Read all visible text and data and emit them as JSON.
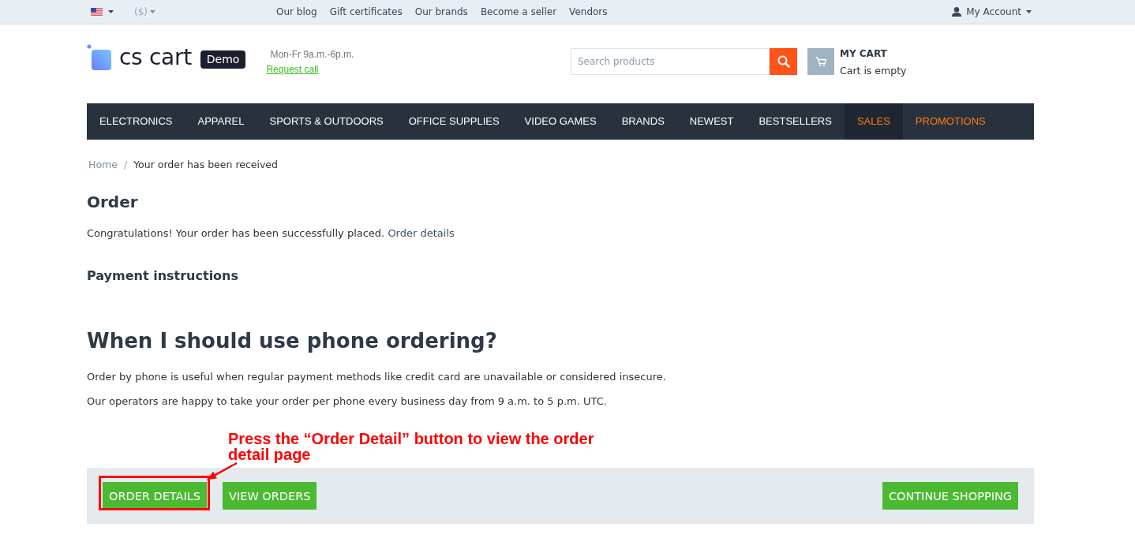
{
  "top_bar": {
    "currency": "($)",
    "links": [
      "Our blog",
      "Gift certificates",
      "Our brands",
      "Become a seller",
      "Vendors"
    ],
    "account": "My Account"
  },
  "header": {
    "logo_text": "cs cart",
    "logo_badge": "Demo",
    "hours": "Mon-Fr 9a.m.-6p.m.",
    "request_call": "Request call",
    "search": {
      "placeholder": "Search products"
    },
    "cart": {
      "title": "MY CART",
      "status": "Cart is empty"
    }
  },
  "menu": [
    {
      "label": "ELECTRONICS",
      "kind": "regular",
      "highlighted": false
    },
    {
      "label": "APPAREL",
      "kind": "regular",
      "highlighted": false
    },
    {
      "label": "SPORTS & OUTDOORS",
      "kind": "regular",
      "highlighted": false
    },
    {
      "label": "OFFICE SUPPLIES",
      "kind": "regular",
      "highlighted": false
    },
    {
      "label": "VIDEO GAMES",
      "kind": "regular",
      "highlighted": false
    },
    {
      "label": "BRANDS",
      "kind": "regular",
      "highlighted": false
    },
    {
      "label": "NEWEST",
      "kind": "regular",
      "highlighted": false
    },
    {
      "label": "BESTSELLERS",
      "kind": "regular",
      "highlighted": false
    },
    {
      "label": "SALES",
      "kind": "promo",
      "highlighted": true
    },
    {
      "label": "PROMOTIONS",
      "kind": "promo",
      "highlighted": false
    }
  ],
  "breadcrumbs": {
    "separator": "/",
    "items": [
      {
        "label": "Home",
        "kind": "link"
      },
      {
        "label": "Your order has been received",
        "kind": "current"
      }
    ]
  },
  "order": {
    "title": "Order",
    "message": "Congratulations! Your order has been successfully placed.",
    "link": "Order details",
    "payment_title": "Payment instructions"
  },
  "phone_ordering": {
    "title": "When I should use phone ordering?",
    "paragraphs": [
      "Order by phone is useful when regular payment methods like credit card are unavailable or considered insecure.",
      "Our operators are happy to take your order per phone every business day from 9 a.m. to 5 p.m. UTC."
    ]
  },
  "annotation": {
    "text": "Press the “Order Detail” button to view the order detail page"
  },
  "actions": {
    "left": [
      {
        "label": "ORDER DETAILS",
        "highlighted": true
      },
      {
        "label": "VIEW ORDERS",
        "highlighted": false
      }
    ],
    "right": [
      {
        "label": "CONTINUE SHOPPING",
        "highlighted": false
      }
    ]
  }
}
